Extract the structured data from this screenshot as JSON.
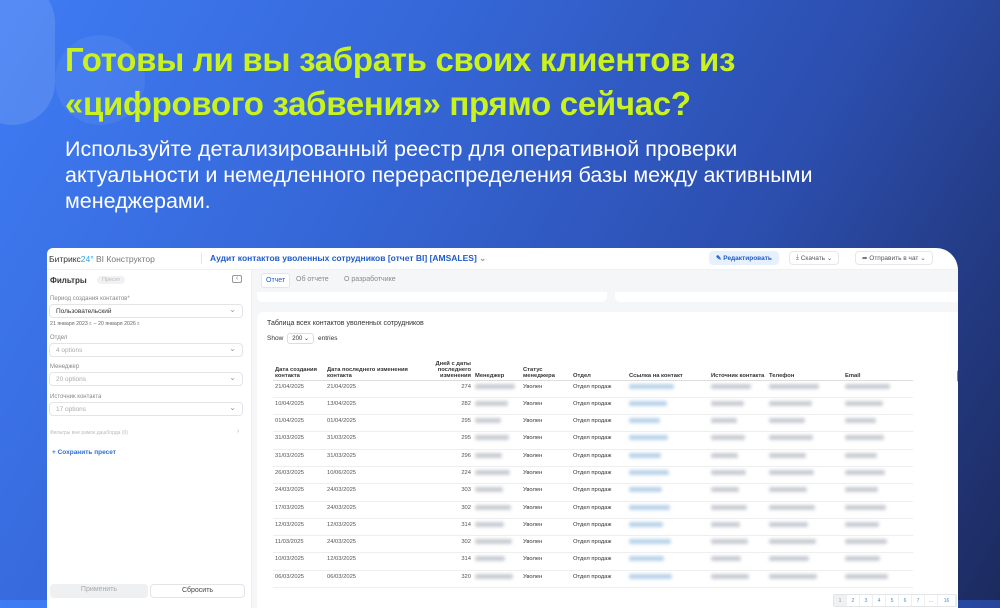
{
  "headline": {
    "line1": "Готовы ли вы забрать своих клиентов из",
    "line2": "«цифрового забвения» прямо сейчас?"
  },
  "subtitle": {
    "line1": "Используйте детализированный реестр для оперативной проверки",
    "line2": "актуальности и немедленного перераспределения базы между активными",
    "line3": "менеджерами."
  },
  "app": {
    "logo_main": "Битрикс",
    "logo_num": "24",
    "logo_product": "BI Конструктор",
    "report_title": "Аудит контактов уволенных сотрудников [отчет BI] [AMSALES]",
    "edit": "Редактировать",
    "download": "Скачать",
    "send": "Отправить в чат"
  },
  "filters": {
    "title": "Фильтры",
    "preset_badge": "Пресет",
    "period_label": "Период создания контактов*",
    "period_value": "Пользовательский",
    "period_range": "21 января 2023 г. – 20 января 2026 г.",
    "dept_label": "Отдел",
    "dept_value": "4 options",
    "manager_label": "Менеджер",
    "manager_value": "20 options",
    "source_label": "Источник контакта",
    "source_value": "17 options",
    "outside": "Фильтры вне рамок дашборда (0)",
    "save_preset": "+ Сохранить пресет",
    "apply": "Применить",
    "reset": "Сбросить"
  },
  "tabs": [
    "Отчет",
    "Об отчете",
    "О разработчике"
  ],
  "table": {
    "title": "Таблица всех контактов уволенных сотрудников",
    "show": "Show",
    "entries_value": "200",
    "entries": "entries",
    "headers": [
      "Дата создания контакта",
      "Дата последнего изменения контакта",
      "Дней с даты последнего изменения",
      "Менеджер",
      "Статус менеджера",
      "Отдел",
      "Ссылка на контакт",
      "Источник контакта",
      "Телефон",
      "Email"
    ],
    "rows": [
      [
        "21/04/2025",
        "21/04/2025",
        "274",
        "Уволен",
        "Отдел продаж"
      ],
      [
        "10/04/2025",
        "13/04/2025",
        "282",
        "Уволен",
        "Отдел продаж"
      ],
      [
        "01/04/2025",
        "01/04/2025",
        "295",
        "Уволен",
        "Отдел продаж"
      ],
      [
        "31/03/2025",
        "31/03/2025",
        "295",
        "Уволен",
        "Отдел продаж"
      ],
      [
        "31/03/2025",
        "31/03/2025",
        "296",
        "Уволен",
        "Отдел продаж"
      ],
      [
        "26/03/2025",
        "10/06/2025",
        "224",
        "Уволен",
        "Отдел продаж"
      ],
      [
        "24/03/2025",
        "24/03/2025",
        "303",
        "Уволен",
        "Отдел продаж"
      ],
      [
        "17/03/2025",
        "24/03/2025",
        "302",
        "Уволен",
        "Отдел продаж"
      ],
      [
        "12/03/2025",
        "12/03/2025",
        "314",
        "Уволен",
        "Отдел продаж"
      ],
      [
        "11/03/2025",
        "24/03/2025",
        "302",
        "Уволен",
        "Отдел продаж"
      ],
      [
        "10/03/2025",
        "12/03/2025",
        "314",
        "Уволен",
        "Отдел продаж"
      ],
      [
        "06/03/2025",
        "06/03/2025",
        "320",
        "Уволен",
        "Отдел продаж"
      ]
    ],
    "pages": [
      "1",
      "2",
      "3",
      "4",
      "5",
      "6",
      "7",
      "...",
      "16"
    ]
  }
}
